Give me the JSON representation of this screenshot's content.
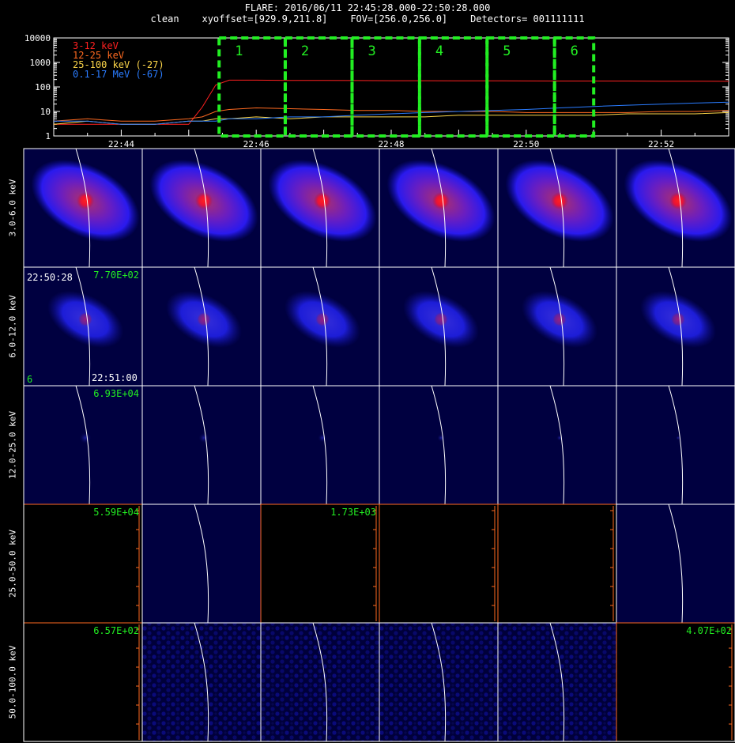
{
  "header": {
    "title": "FLARE: 2016/06/11 22:45:28.000-22:50:28.000",
    "line2_mode": "clean",
    "line2_xyoffset": "xyoffset=[929.9,211.8]",
    "line2_fov": "FOV=[256.0,256.0]",
    "line2_detectors": "Detectors= 001111111"
  },
  "colors": {
    "band_3_12": "#ff2020",
    "band_12_25": "#ff6a20",
    "band_25_100": "#ffd84a",
    "band_01_17": "#2a7cff",
    "interval_box": "#22ee22",
    "axis_orange": "#ff6a20",
    "map_bg": "#000040"
  },
  "chart_data": [
    {
      "type": "line",
      "name": "lightcurve",
      "xlabel": "",
      "ylabel": "",
      "yscale": "log",
      "ylim": [
        1,
        10000
      ],
      "ytick_labels": [
        "1",
        "10",
        "100",
        "1000",
        "10000"
      ],
      "xtick_labels": [
        "22:44",
        "22:46",
        "22:48",
        "22:50",
        "22:52"
      ],
      "legend": [
        {
          "label": "3-12 keV",
          "color": "#ff2020"
        },
        {
          "label": "12-25 keV",
          "color": "#ff6a20"
        },
        {
          "label": "25-100 keV (-27)",
          "color": "#ffd84a"
        },
        {
          "label": "0.1-17 MeV (-67)",
          "color": "#2a7cff"
        }
      ],
      "x_minutes": [
        0,
        0.5,
        1,
        1.5,
        2,
        2.2,
        2.4,
        2.6,
        3,
        3.5,
        4,
        4.5,
        5,
        5.5,
        6,
        6.5,
        7,
        7.5,
        8,
        8.5,
        9,
        9.5,
        10
      ],
      "series": [
        {
          "name": "3-12 keV",
          "values": [
            3,
            3,
            3,
            3,
            3,
            15,
            120,
            190,
            190,
            185,
            185,
            183,
            180,
            180,
            178,
            178,
            176,
            175,
            175,
            174,
            172,
            172,
            170
          ]
        },
        {
          "name": "12-25 keV",
          "values": [
            4,
            5,
            4,
            4,
            5,
            6,
            10,
            12,
            14,
            13,
            12,
            11,
            11,
            10,
            10,
            10,
            9,
            9,
            9,
            9,
            10,
            10,
            11
          ]
        },
        {
          "name": "25-100 keV (-27)",
          "values": [
            3,
            4,
            3,
            3,
            4,
            4,
            5,
            5,
            6,
            5,
            6,
            6,
            6,
            6,
            7,
            7,
            7,
            7,
            7,
            8,
            8,
            8,
            9
          ]
        },
        {
          "name": "0.1-17 MeV (-67)",
          "values": [
            4,
            4,
            3,
            3,
            4,
            4,
            4,
            5,
            5,
            6,
            6,
            7,
            8,
            9,
            10,
            11,
            12,
            14,
            16,
            18,
            20,
            22,
            24
          ]
        }
      ],
      "intervals": [
        {
          "label": "1",
          "start_min": 2.45,
          "end_min": 3.43
        },
        {
          "label": "2",
          "start_min": 3.43,
          "end_min": 4.42
        },
        {
          "label": "3",
          "start_min": 4.42,
          "end_min": 5.42
        },
        {
          "label": "4",
          "start_min": 5.42,
          "end_min": 6.42
        },
        {
          "label": "5",
          "start_min": 6.42,
          "end_min": 7.42
        },
        {
          "label": "6",
          "start_min": 7.42,
          "end_min": 8.0
        }
      ]
    },
    {
      "type": "heatmap",
      "name": "image-grid",
      "rows": [
        {
          "label": "3.0-6.0 keV",
          "kind": "strong"
        },
        {
          "label": "6.0-12.0 keV",
          "kind": "medium"
        },
        {
          "label": "12.0-25.0 keV",
          "kind": "faint"
        },
        {
          "label": "25.0-50.0 keV",
          "kind": "mixed"
        },
        {
          "label": "50.0-100.0 keV",
          "kind": "noise"
        }
      ],
      "row4_cells": [
        "empty",
        "map",
        "empty",
        "empty",
        "empty",
        "map"
      ],
      "row5_cells": [
        "empty",
        "noise",
        "noise",
        "noise",
        "noise",
        "empty"
      ],
      "annotations": [
        {
          "row": 1,
          "col": 0,
          "text": "7.70E+02"
        },
        {
          "row": 2,
          "col": 0,
          "text": "6.93E+04"
        },
        {
          "row": 3,
          "col": 0,
          "text": "5.59E+04"
        },
        {
          "row": 3,
          "col": 2,
          "text": "1.73E+03"
        },
        {
          "row": 4,
          "col": 0,
          "text": "6.57E+02"
        },
        {
          "row": 4,
          "col": 5,
          "text": "4.07E+02"
        }
      ],
      "time_start": "22:50:28",
      "time_end": "22:51:00",
      "interval_index": "6"
    }
  ]
}
